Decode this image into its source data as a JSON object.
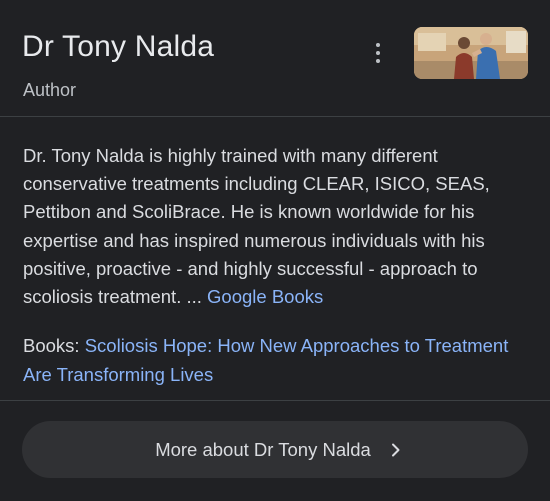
{
  "header": {
    "title": "Dr Tony Nalda",
    "subtitle": "Author",
    "menu_icon": "more-vert-icon",
    "thumbnail_alt": "photo of Dr Tony Nalda treating a patient"
  },
  "description": {
    "text": "Dr. Tony Nalda is highly trained with many different conservative treatments including CLEAR, ISICO, SEAS, Pettibon and ScoliBrace. He is known worldwide for his expertise and has inspired numerous individuals with his positive, proactive - and highly successful - approach to scoliosis treatment. ...",
    "source_link": "Google Books"
  },
  "books": {
    "label": "Books:",
    "title": "Scoliosis Hope: How New Approaches to Treatment Are Transforming Lives"
  },
  "more_button": {
    "label": "More about Dr Tony Nalda",
    "icon": "chevron-right-icon"
  },
  "colors": {
    "background": "#202124",
    "link": "#8ab4f8",
    "button": "#303134",
    "divider": "#3c4043"
  }
}
